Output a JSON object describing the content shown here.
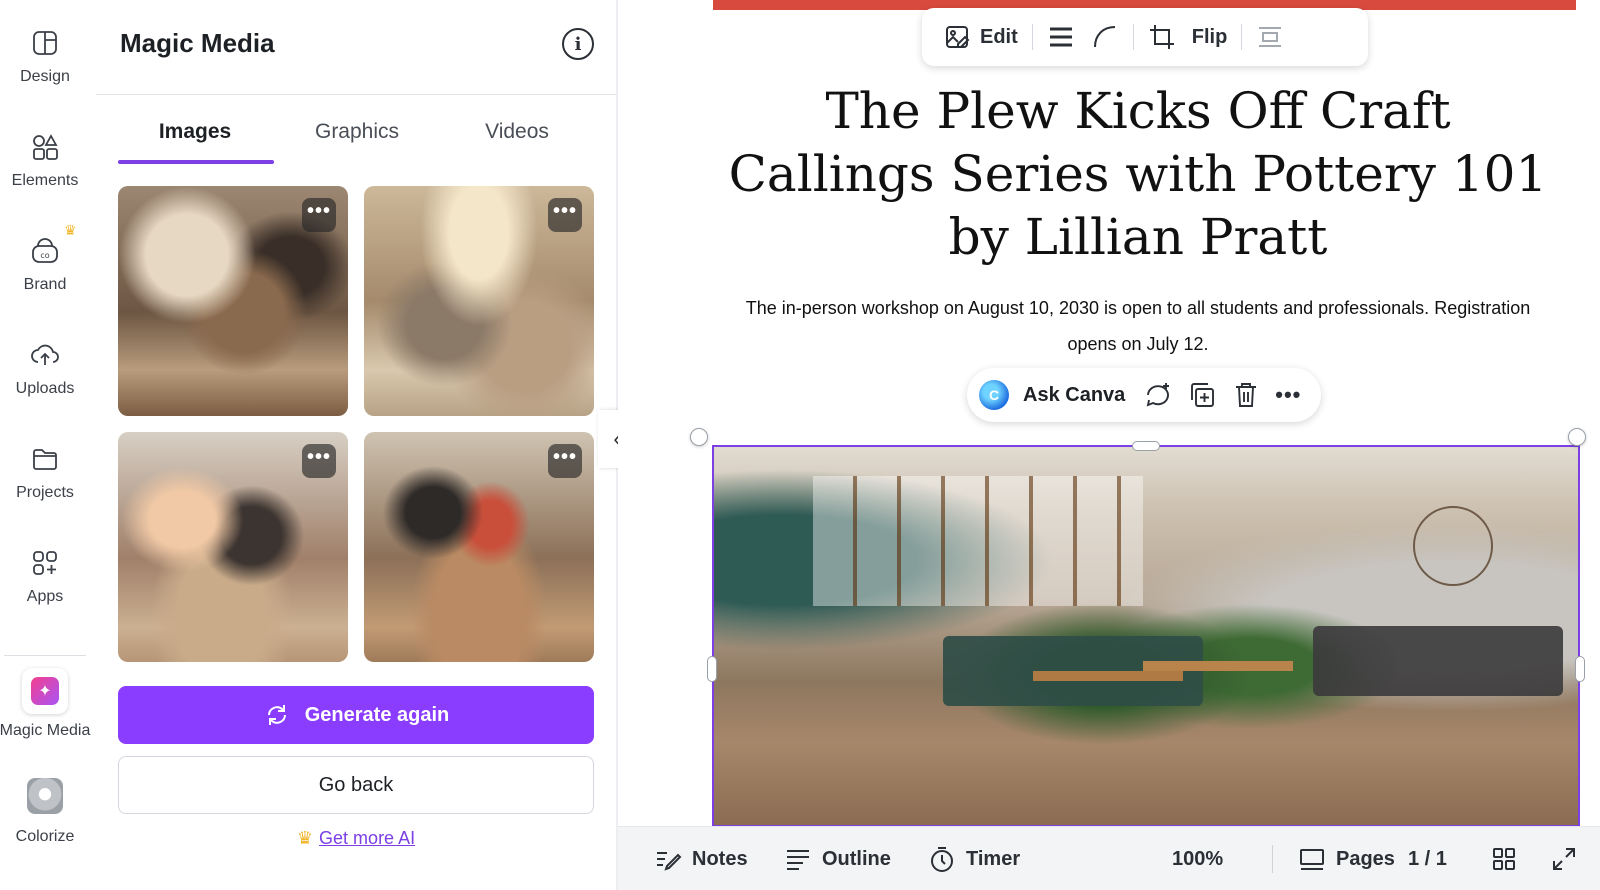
{
  "rail": {
    "items": [
      {
        "label": "Design",
        "icon": "design-icon"
      },
      {
        "label": "Elements",
        "icon": "elements-icon"
      },
      {
        "label": "Brand",
        "icon": "brand-icon"
      },
      {
        "label": "Uploads",
        "icon": "uploads-icon"
      },
      {
        "label": "Projects",
        "icon": "projects-icon"
      },
      {
        "label": "Apps",
        "icon": "apps-icon"
      },
      {
        "label": "Magic Media",
        "icon": "magic-media-icon"
      },
      {
        "label": "Colorize",
        "icon": "colorize-icon"
      }
    ]
  },
  "panel": {
    "title": "Magic Media",
    "tabs": [
      {
        "label": "Images",
        "active": true
      },
      {
        "label": "Graphics",
        "active": false
      },
      {
        "label": "Videos",
        "active": false
      }
    ],
    "more_options_glyph": "•••",
    "generate_label": "Generate again",
    "back_label": "Go back",
    "more_ai_label": "Get more AI"
  },
  "toolbar": {
    "edit_label": "Edit",
    "flip_label": "Flip"
  },
  "document": {
    "title": "The Plew Kicks Off Craft Callings Series with Pottery 101 by Lillian Pratt",
    "subtitle": "The in-person workshop on August 10, 2030 is open to all students and professionals. Registration opens on July 12."
  },
  "ask_bar": {
    "label": "Ask Canva",
    "more_glyph": "•••"
  },
  "bottom_bar": {
    "notes_label": "Notes",
    "outline_label": "Outline",
    "timer_label": "Timer",
    "zoom": "100%",
    "pages_label": "Pages",
    "page_count": "1 / 1"
  },
  "colors": {
    "accent_purple": "#8b3dff",
    "red_bar": "#d94a3e",
    "crown": "#f0b429"
  }
}
